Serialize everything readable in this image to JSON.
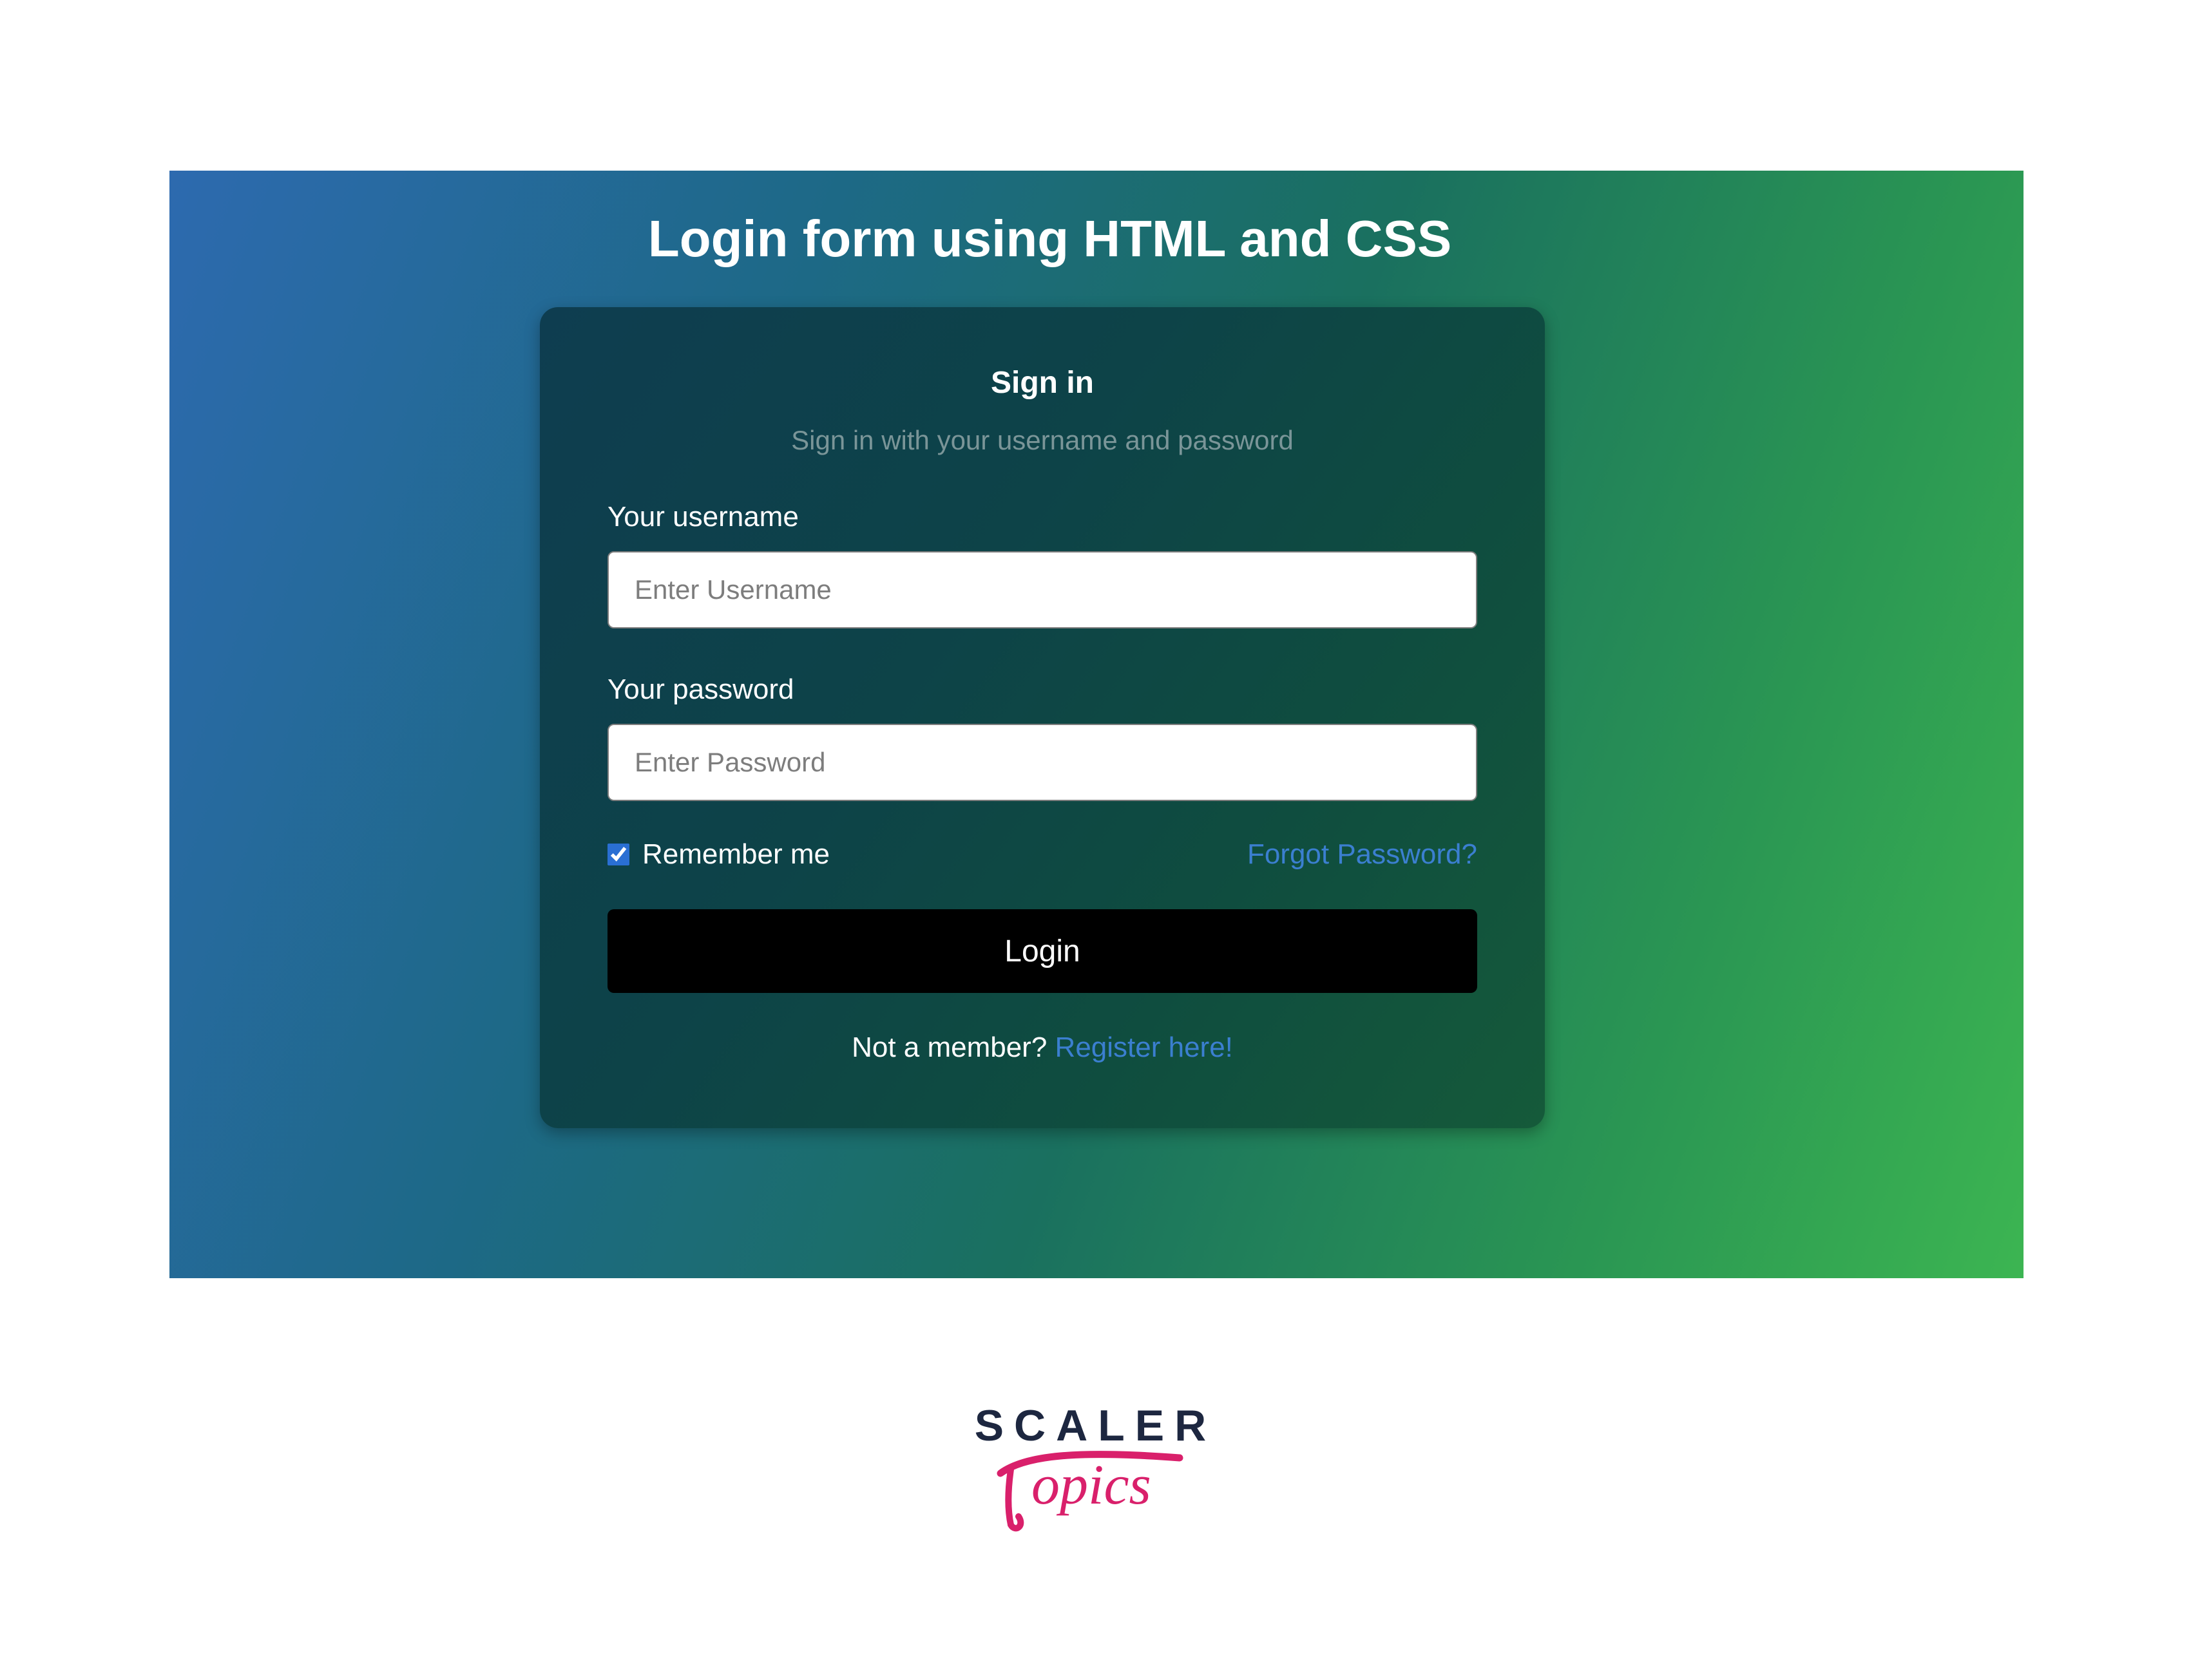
{
  "page": {
    "title": "Login form using HTML and CSS"
  },
  "form": {
    "heading": "Sign in",
    "subheading": "Sign in with your username and password",
    "username": {
      "label": "Your username",
      "placeholder": "Enter Username",
      "value": ""
    },
    "password": {
      "label": "Your password",
      "placeholder": "Enter Password",
      "value": ""
    },
    "remember": {
      "label": "Remember me",
      "checked": true
    },
    "forgot_label": "Forgot Password?",
    "submit_label": "Login",
    "register_prompt": "Not a member? ",
    "register_link": "Register here!"
  },
  "branding": {
    "line1": "SCALER",
    "line2": "Topics"
  }
}
